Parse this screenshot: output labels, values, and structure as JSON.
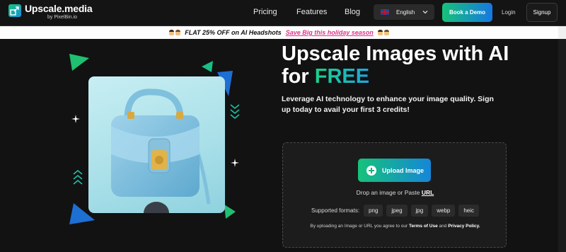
{
  "nav": {
    "logo_name": "Upscale.media",
    "logo_by": "by PixelBin.io",
    "links": [
      "Pricing",
      "Features",
      "Blog"
    ],
    "language": "English",
    "demo_label": "Book a Demo",
    "login_label": "Login",
    "signup_label": "Signup"
  },
  "promo": {
    "text": "FLAT 25% OFF on AI Headshots",
    "link": "Save Big this holiday season"
  },
  "hero": {
    "title_line1": "Upscale Images with AI",
    "title_for": "for",
    "title_free": "FREE",
    "subtitle": "Leverage AI technology to enhance your image quality. Sign up today to avail your first 3 credits!"
  },
  "upload": {
    "button_label": "Upload Image",
    "drop_text": "Drop an image or Paste",
    "url_label": "URL",
    "formats_label": "Supported formats:",
    "formats": [
      "png",
      "jpeg",
      "jpg",
      "webp",
      "heic"
    ],
    "terms_prefix": "By uploading an Image or URL you agree to our",
    "terms_link": "Terms of Use",
    "terms_and": "and",
    "privacy_link": "Privacy Policy."
  },
  "colors": {
    "brand_green": "#16c27a",
    "brand_blue": "#1678e2",
    "promo_link": "#e0338c"
  }
}
